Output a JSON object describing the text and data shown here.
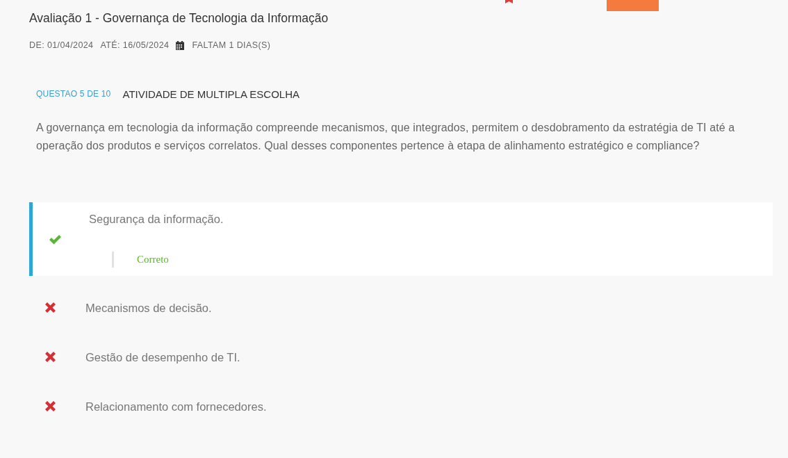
{
  "assessment": {
    "title": "Avaliação 1 - Governança de Tecnologia da Informação",
    "start": "DE: 01/04/2024",
    "end": "ATÉ: 16/05/2024",
    "remaining": "FALTAM 1 DIAS(S)"
  },
  "question": {
    "counter": "QUESTAO 5 DE 10",
    "type": "ATIVIDADE DE MULTIPLA ESCOLHA",
    "text": "A governança em tecnologia da informação compreende mecanismos, que integrados, permitem o desdobramento da estratégia de TI até a operação dos produtos e serviços correlatos. Qual desses componentes pertence à etapa de alinhamento estratégico e compliance?"
  },
  "options": [
    {
      "text": "Segurança da informação.",
      "selected": true,
      "correct": true,
      "feedback": "Correto"
    },
    {
      "text": "Mecanismos de decisão.",
      "selected": false,
      "correct": false
    },
    {
      "text": "Gestão de desempenho de TI.",
      "selected": false,
      "correct": false
    },
    {
      "text": "Relacionamento com fornecedores.",
      "selected": false,
      "correct": false
    }
  ]
}
